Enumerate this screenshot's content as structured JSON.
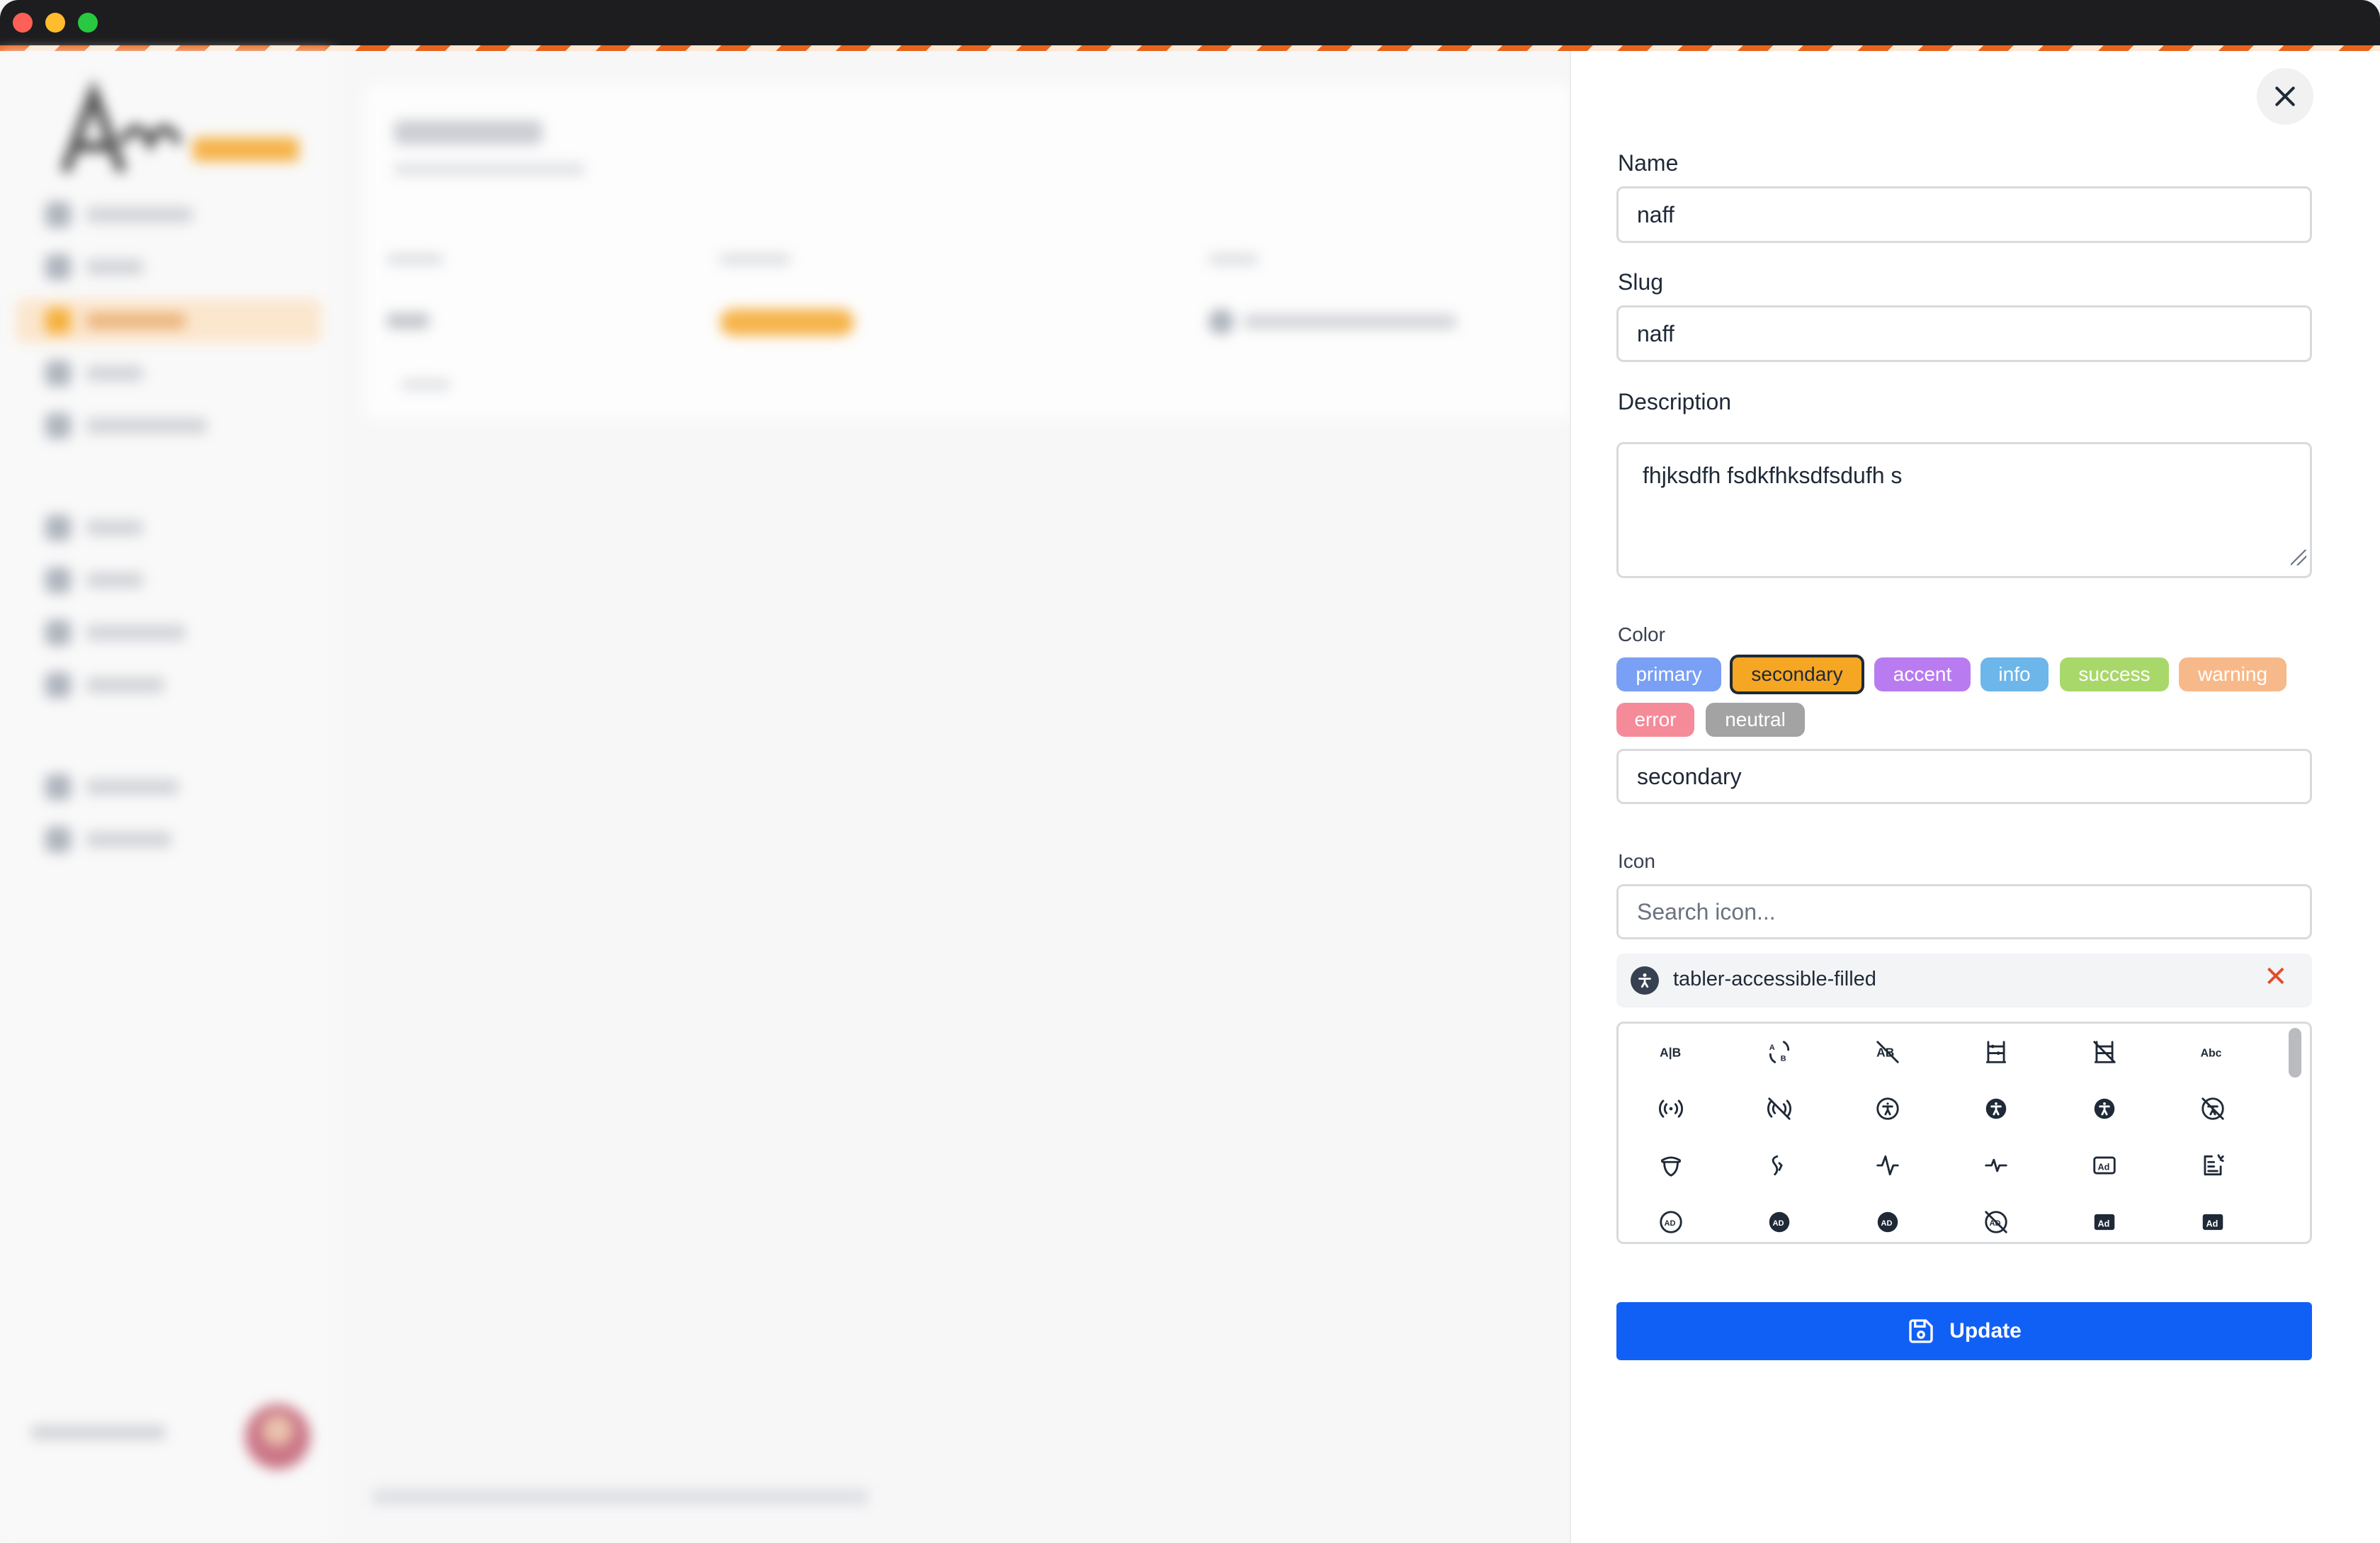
{
  "drawer": {
    "name_label": "Name",
    "name_value": "naff",
    "slug_label": "Slug",
    "slug_value": "naff",
    "description_label": "Description",
    "description_value": "fhjksdfh fsdkfhksdfsdufh s",
    "color_label": "Color",
    "color_options": [
      {
        "label": "primary",
        "bg": "#7aa0f5"
      },
      {
        "label": "secondary",
        "bg": "#f5a623",
        "selected": true
      },
      {
        "label": "accent",
        "bg": "#b97cf0"
      },
      {
        "label": "info",
        "bg": "#6db6ea"
      },
      {
        "label": "success",
        "bg": "#a9d86a"
      },
      {
        "label": "warning",
        "bg": "#f7b98a"
      },
      {
        "label": "error",
        "bg": "#f58a99"
      },
      {
        "label": "neutral",
        "bg": "#a3a3a3"
      }
    ],
    "color_value": "secondary",
    "icon_label": "Icon",
    "icon_search_placeholder": "Search icon...",
    "selected_icon": "tabler-accessible-filled",
    "update_label": "Update"
  },
  "icon_grid": [
    "a-b-icon",
    "a-b-2-icon",
    "a-b-off-icon",
    "abacus-icon",
    "abacus-off-icon",
    "abc-icon",
    "access-point-icon",
    "access-point-off-icon",
    "accessible-icon",
    "accessible-filled-icon",
    "accessible-filled-alt-icon",
    "accessible-off-icon",
    "acorn-icon",
    "activity-heartbeat-icon",
    "activity-icon",
    "activity-alt-icon",
    "ad-icon",
    "ad-2-icon",
    "ad-circle-icon",
    "ad-circle-filled-icon",
    "ad-circle-filled-alt-icon",
    "ad-circle-off-icon",
    "ad-filled-icon",
    "ad-filled-alt-icon"
  ],
  "colors": {
    "accent": "#1160f6",
    "close_x": "#e54b2b",
    "brand": "#f6a31e"
  }
}
